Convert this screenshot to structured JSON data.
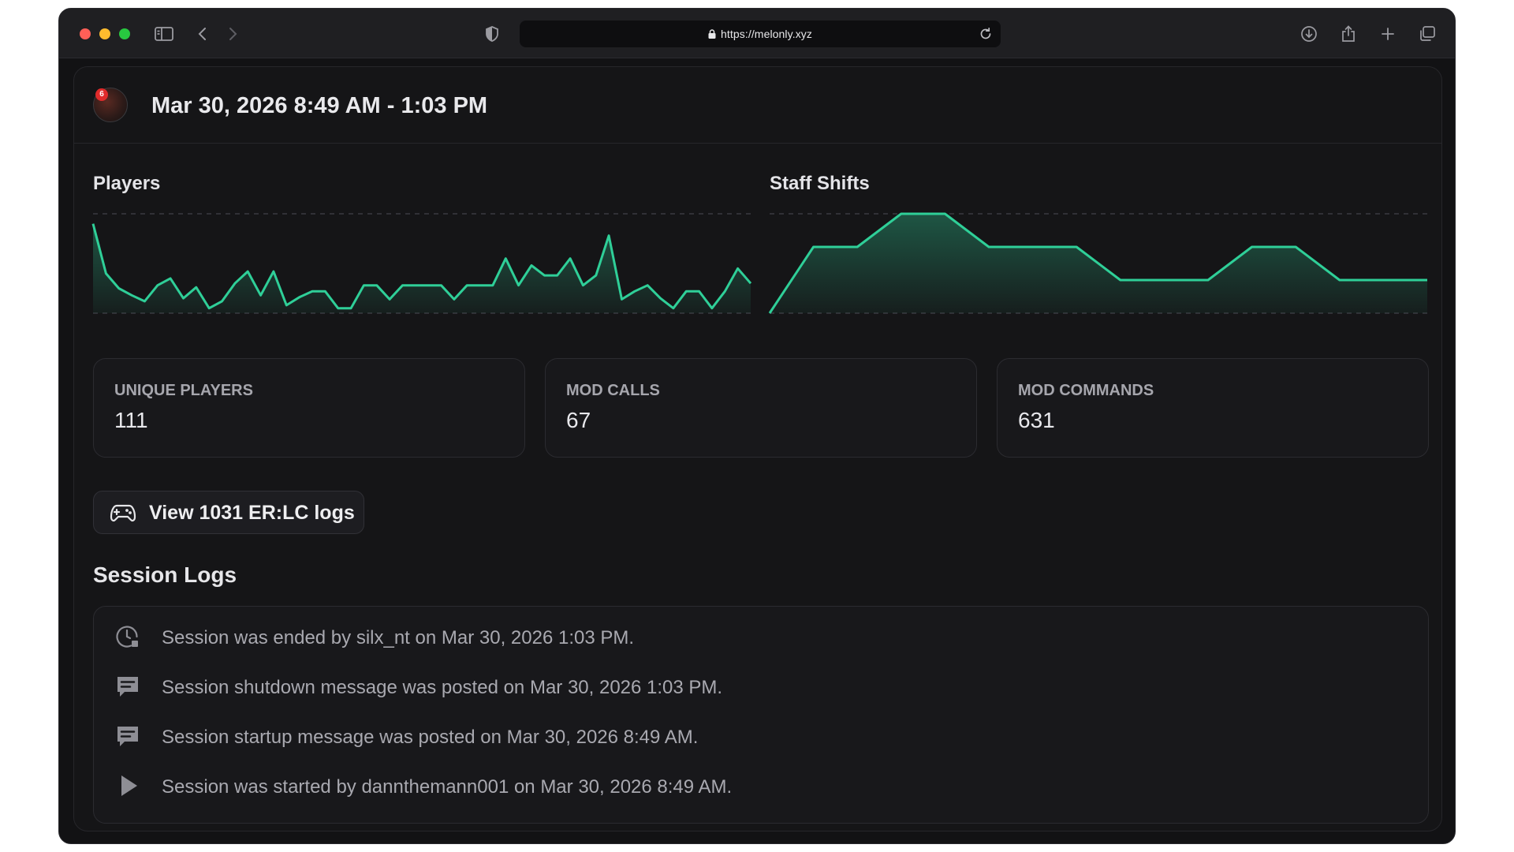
{
  "browser": {
    "url": "https://melonly.xyz"
  },
  "header": {
    "avatar_badge": "6",
    "title": "Mar 30, 2026 8:49 AM - 1:03 PM"
  },
  "charts": {
    "players_label": "Players",
    "staff_label": "Staff Shifts",
    "line_color": "#2fcf98"
  },
  "chart_data": [
    {
      "type": "area",
      "title": "Players",
      "x": [
        0,
        1,
        2,
        3,
        4,
        5,
        6,
        7,
        8,
        9,
        10,
        11,
        12,
        13,
        14,
        15,
        16,
        17,
        18,
        19,
        20,
        21,
        22,
        23,
        24,
        25,
        26,
        27,
        28,
        29,
        30,
        31,
        32,
        33,
        34,
        35,
        36,
        37,
        38,
        39,
        40,
        41,
        42,
        43,
        44,
        45,
        46,
        47,
        48,
        49,
        50,
        51
      ],
      "values": [
        90,
        40,
        25,
        18,
        12,
        28,
        35,
        15,
        26,
        5,
        12,
        30,
        42,
        18,
        42,
        8,
        16,
        22,
        22,
        5,
        5,
        28,
        28,
        14,
        28,
        28,
        28,
        28,
        14,
        28,
        28,
        28,
        55,
        28,
        48,
        38,
        38,
        55,
        28,
        38,
        78,
        14,
        22,
        28,
        15,
        5,
        22,
        22,
        5,
        22,
        45,
        30
      ],
      "ylim": [
        0,
        100
      ],
      "grid": true
    },
    {
      "type": "area",
      "title": "Staff Shifts",
      "x": [
        0,
        1,
        2,
        3,
        4,
        5,
        6,
        7,
        8,
        9,
        10,
        11,
        12,
        13,
        14,
        15
      ],
      "values": [
        0,
        2,
        2,
        3,
        3,
        2,
        2,
        2,
        1,
        1,
        1,
        2,
        2,
        1,
        1,
        1
      ],
      "ylim": [
        0,
        3
      ],
      "grid": true
    }
  ],
  "stats": [
    {
      "label": "UNIQUE PLAYERS",
      "value": "111"
    },
    {
      "label": "MOD CALLS",
      "value": "67"
    },
    {
      "label": "MOD COMMANDS",
      "value": "631"
    }
  ],
  "logs_button": {
    "label": "View 1031 ER:LC logs"
  },
  "session_logs": {
    "title": "Session Logs",
    "items": [
      {
        "icon": "clock-icon",
        "text": "Session was ended by silx_nt on Mar 30, 2026 1:03 PM."
      },
      {
        "icon": "message-icon",
        "text": "Session shutdown message was posted on Mar 30, 2026 1:03 PM."
      },
      {
        "icon": "message-icon",
        "text": "Session startup message was posted on Mar 30, 2026 8:49 AM."
      },
      {
        "icon": "play-icon",
        "text": "Session was started by dannthemann001 on Mar 30, 2026 8:49 AM."
      }
    ]
  }
}
